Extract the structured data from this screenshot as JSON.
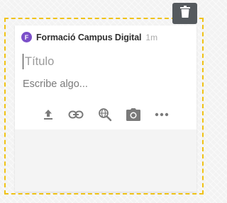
{
  "post": {
    "author_initial": "F",
    "author_name": "Formació Campus Digital",
    "timestamp": "1m",
    "avatar_color": "#7b4fc9",
    "title_placeholder": "Título",
    "body_placeholder": "Escribe algo..."
  },
  "toolbar": {
    "icons": [
      "upload-icon",
      "link-icon",
      "web-search-icon",
      "camera-icon",
      "more-icon"
    ]
  },
  "actions": {
    "delete_icon": "trash-icon"
  },
  "colors": {
    "dashed_border": "#f0c214",
    "delete_button_bg": "#555a5e",
    "icon_gray": "#7a7a7a"
  }
}
